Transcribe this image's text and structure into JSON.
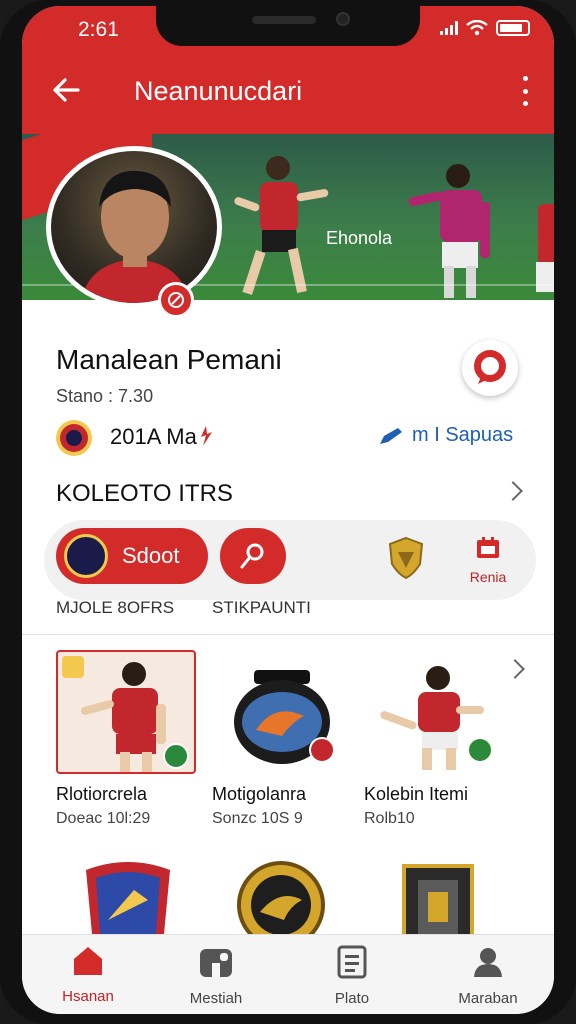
{
  "status": {
    "time": "2:61"
  },
  "header": {
    "title": "Neanunucdari",
    "back_icon": "arrow-left-icon",
    "more_icon": "more-vertical-icon"
  },
  "hero": {
    "caption": "Ehonola"
  },
  "profile": {
    "name": "Manalean Pemani",
    "meta": "Stano : 7.30",
    "club": "201A Ma",
    "link": "m I Sapuas"
  },
  "collection": {
    "title": "KOLEOTO ITRS",
    "pills": {
      "scout_label": "Sdoot",
      "rank_label": "Renia"
    },
    "sub_labels": [
      "MJOLE 8OFRS",
      "STIKPAUNTI"
    ]
  },
  "cards": [
    {
      "name": "Rlotiorcrela",
      "number": "Doeac 10l:29"
    },
    {
      "name": "Motigolanra",
      "number": "Sonzc 10S 9"
    },
    {
      "name": "Kolebin Itemi",
      "number": "Rolb10"
    }
  ],
  "nav": [
    {
      "label": "Hsanan",
      "icon": "home-icon",
      "active": true
    },
    {
      "label": "Mestiah",
      "icon": "puzzle-icon",
      "active": false
    },
    {
      "label": "Plato",
      "icon": "document-icon",
      "active": false
    },
    {
      "label": "Maraban",
      "icon": "person-icon",
      "active": false
    }
  ],
  "colors": {
    "accent": "#d32a2a",
    "link": "#1e5fb3"
  }
}
